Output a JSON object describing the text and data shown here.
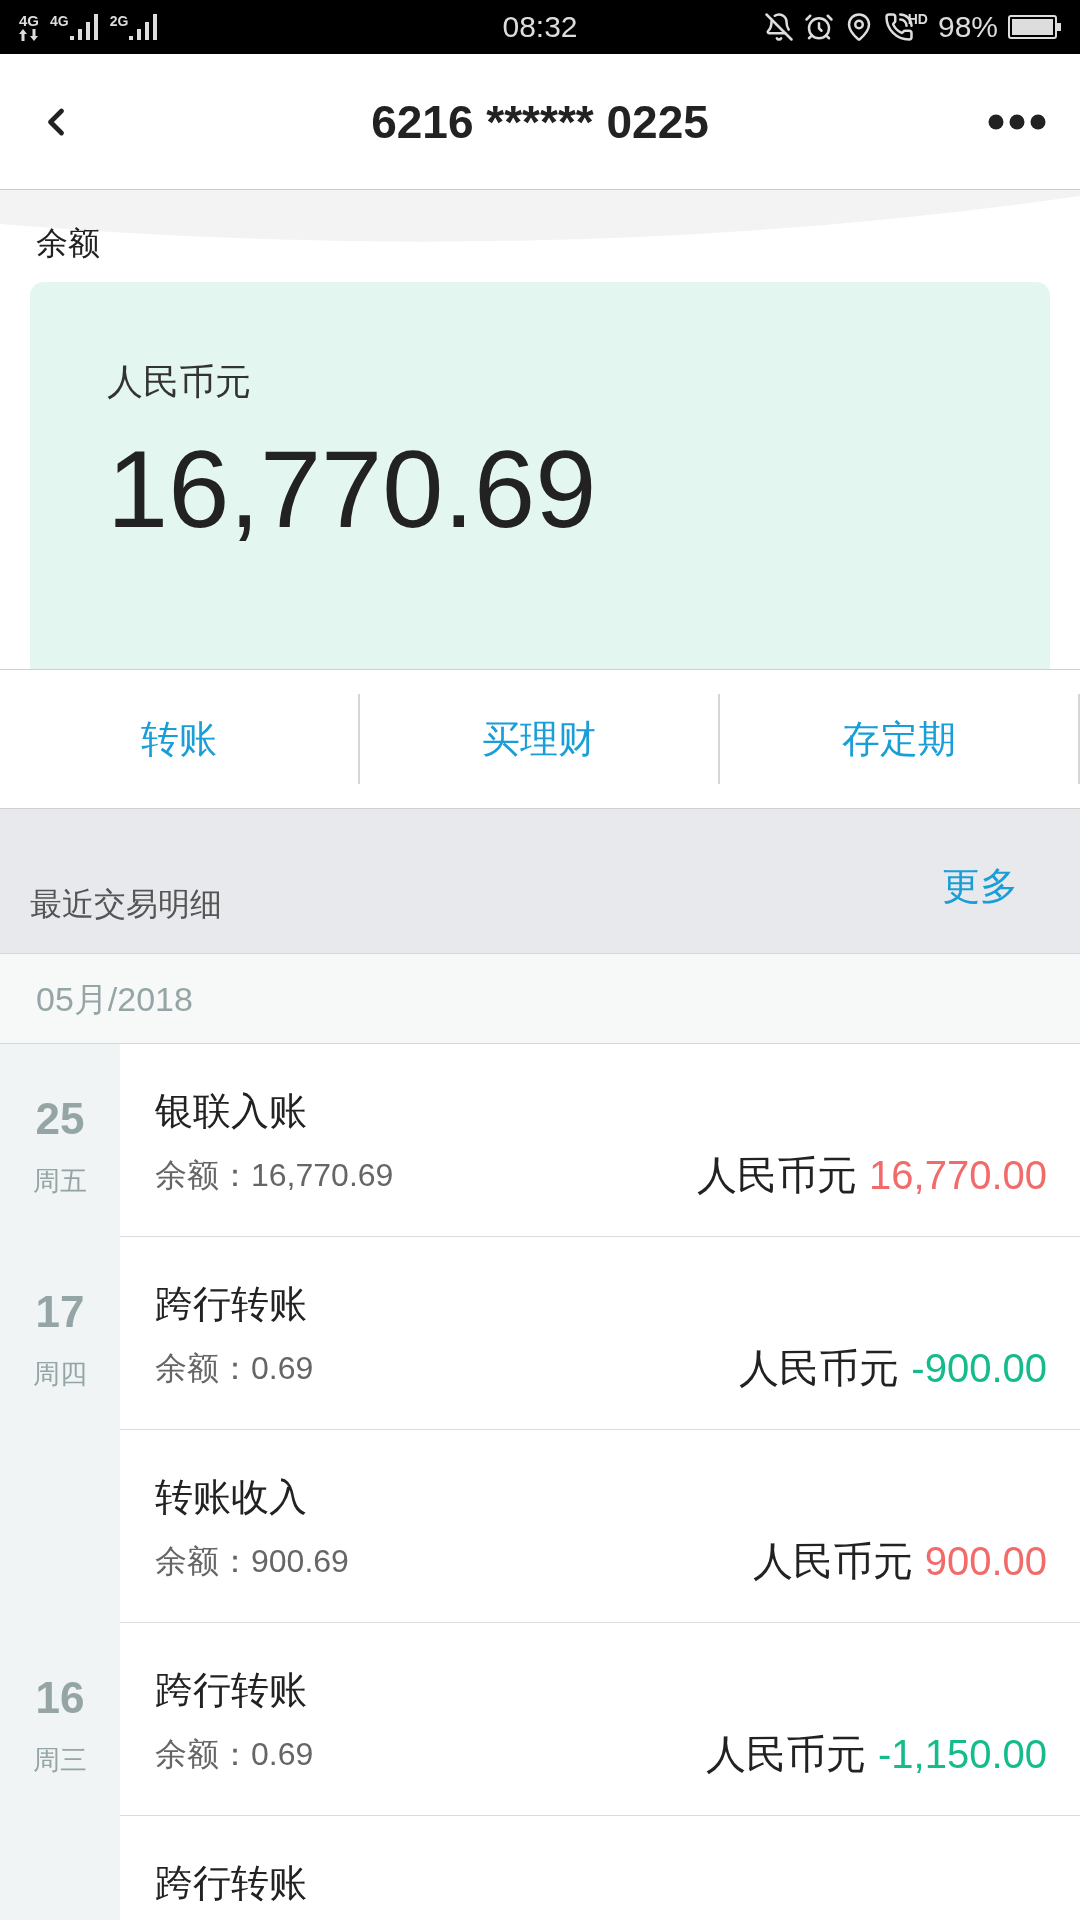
{
  "status_bar": {
    "data_label": "4G",
    "signals": [
      {
        "label": "4G"
      },
      {
        "label": "2G"
      }
    ],
    "time": "08:32",
    "call_label": "HD",
    "battery": "98%"
  },
  "header": {
    "title": "6216 ****** 0225"
  },
  "balance": {
    "label": "余额",
    "currency": "人民币元",
    "amount": "16,770.69"
  },
  "actions": [
    {
      "label": "转账"
    },
    {
      "label": "买理财"
    },
    {
      "label": "存定期"
    }
  ],
  "recent": {
    "title": "最近交易明细",
    "more": "更多",
    "month": "05月/2018"
  },
  "days": [
    {
      "day": "25",
      "weekday": "周五",
      "transactions": [
        {
          "title": "银联入账",
          "balance": "余额：16,770.69",
          "currency": "人民币元",
          "amount": "16,770.00",
          "kind": "credit"
        }
      ]
    },
    {
      "day": "17",
      "weekday": "周四",
      "transactions": [
        {
          "title": "跨行转账",
          "balance": "余额：0.69",
          "currency": "人民币元",
          "amount": "-900.00",
          "kind": "debit"
        },
        {
          "title": "转账收入",
          "balance": "余额：900.69",
          "currency": "人民币元",
          "amount": "900.00",
          "kind": "credit"
        }
      ]
    },
    {
      "day": "16",
      "weekday": "周三",
      "transactions": [
        {
          "title": "跨行转账",
          "balance": "余额：0.69",
          "currency": "人民币元",
          "amount": "-1,150.00",
          "kind": "debit"
        },
        {
          "title": "跨行转账"
        }
      ]
    }
  ]
}
